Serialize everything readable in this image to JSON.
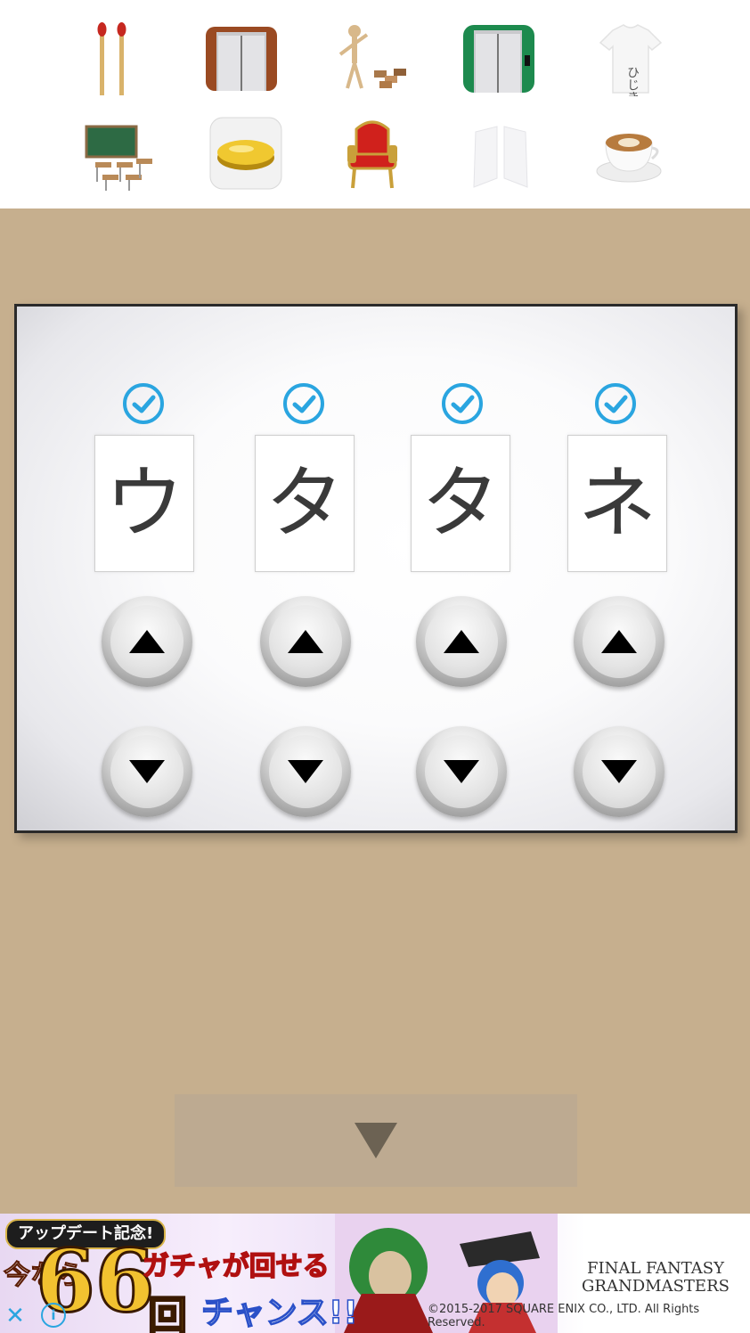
{
  "inventory": {
    "items": [
      {
        "name": "matches"
      },
      {
        "name": "elevator-brown"
      },
      {
        "name": "wooden-mannequin"
      },
      {
        "name": "elevator-green"
      },
      {
        "name": "tshirt",
        "label": "ひじき"
      },
      {
        "name": "classroom"
      },
      {
        "name": "gold-coin"
      },
      {
        "name": "red-throne"
      },
      {
        "name": "white-shape"
      },
      {
        "name": "latte"
      }
    ]
  },
  "puzzle": {
    "slots": [
      {
        "char": "ウ",
        "checked": true
      },
      {
        "char": "タ",
        "checked": true
      },
      {
        "char": "タ",
        "checked": true
      },
      {
        "char": "ネ",
        "checked": true
      }
    ]
  },
  "colors": {
    "background": "#c6af8e",
    "check": "#2aa5e0",
    "back_button": "#bdaa91"
  },
  "ad": {
    "badge": "アップデート記念!",
    "prefix": "今なら",
    "number": "66",
    "counter": "回",
    "line1": "ガチャが回せる",
    "line2": "チャンス!!",
    "logo_line1": "FINAL FANTASY",
    "logo_line2": "GRANDMASTERS",
    "copyright": "©2015-2017 SQUARE ENIX CO., LTD. All Rights Reserved.",
    "close": "✕",
    "info": "i"
  }
}
